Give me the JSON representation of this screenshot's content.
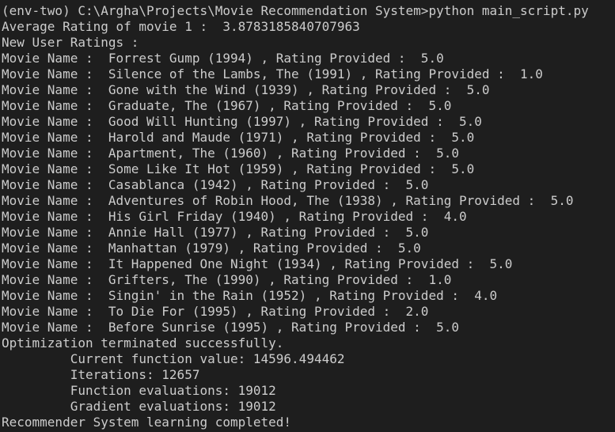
{
  "terminal": {
    "lines": [
      "(env-two) C:\\Argha\\Projects\\Movie Recommendation System>python main_script.py",
      "Average Rating of movie 1 :  3.8783185840707963",
      "New User Ratings :",
      "Movie Name :  Forrest Gump (1994) , Rating Provided :  5.0",
      "Movie Name :  Silence of the Lambs, The (1991) , Rating Provided :  1.0",
      "Movie Name :  Gone with the Wind (1939) , Rating Provided :  5.0",
      "Movie Name :  Graduate, The (1967) , Rating Provided :  5.0",
      "Movie Name :  Good Will Hunting (1997) , Rating Provided :  5.0",
      "Movie Name :  Harold and Maude (1971) , Rating Provided :  5.0",
      "Movie Name :  Apartment, The (1960) , Rating Provided :  5.0",
      "Movie Name :  Some Like It Hot (1959) , Rating Provided :  5.0",
      "Movie Name :  Casablanca (1942) , Rating Provided :  5.0",
      "Movie Name :  Adventures of Robin Hood, The (1938) , Rating Provided :  5.0",
      "Movie Name :  His Girl Friday (1940) , Rating Provided :  4.0",
      "Movie Name :  Annie Hall (1977) , Rating Provided :  5.0",
      "Movie Name :  Manhattan (1979) , Rating Provided :  5.0",
      "Movie Name :  It Happened One Night (1934) , Rating Provided :  5.0",
      "Movie Name :  Grifters, The (1990) , Rating Provided :  1.0",
      "Movie Name :  Singin' in the Rain (1952) , Rating Provided :  4.0",
      "Movie Name :  To Die For (1995) , Rating Provided :  2.0",
      "Movie Name :  Before Sunrise (1995) , Rating Provided :  5.0",
      "Optimization terminated successfully.",
      "         Current function value: 14596.494462",
      "         Iterations: 12657",
      "         Function evaluations: 19012",
      "         Gradient evaluations: 19012",
      "Recommender System learning completed!"
    ]
  }
}
